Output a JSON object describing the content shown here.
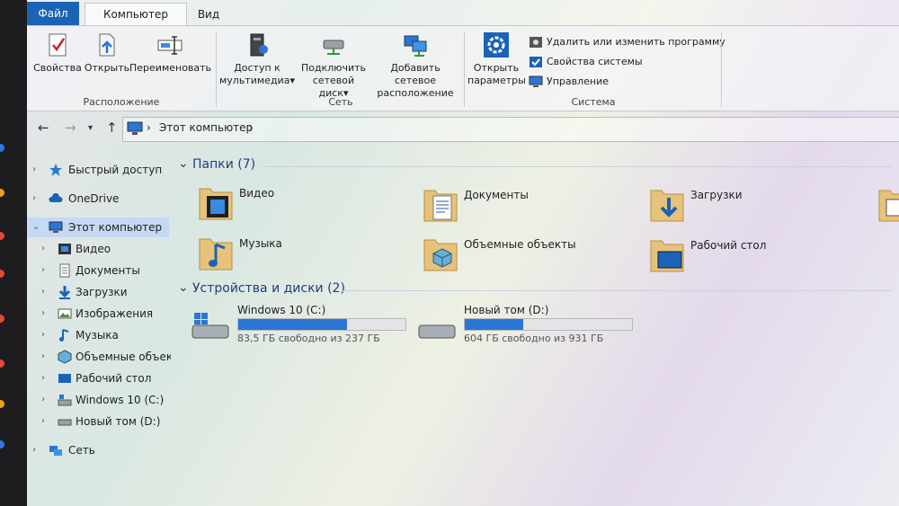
{
  "ribbon": {
    "tabs": {
      "file": "Файл",
      "computer": "Компьютер",
      "view": "Вид"
    },
    "location": {
      "properties": "Свойства",
      "open": "Открыть",
      "rename": "Переименовать",
      "label": "Расположение"
    },
    "network": {
      "media_access_line1": "Доступ к",
      "media_access_line2": "мультимедиа",
      "map_drive_line1": "Подключить",
      "map_drive_line2": "сетевой диск",
      "add_location_line1": "Добавить сетевое",
      "add_location_line2": "расположение",
      "label": "Сеть"
    },
    "system": {
      "open_settings_line1": "Открыть",
      "open_settings_line2": "параметры",
      "uninstall": "Удалить или изменить программу",
      "properties": "Свойства системы",
      "manage": "Управление",
      "label": "Система"
    }
  },
  "address": {
    "crumb": "Этот компьютер"
  },
  "sidebar": {
    "items": [
      {
        "label": "Быстрый доступ"
      },
      {
        "label": "OneDrive"
      },
      {
        "label": "Этот компьютер"
      },
      {
        "label": "Видео"
      },
      {
        "label": "Документы"
      },
      {
        "label": "Загрузки"
      },
      {
        "label": "Изображения"
      },
      {
        "label": "Музыка"
      },
      {
        "label": "Объемные объекты"
      },
      {
        "label": "Рабочий стол"
      },
      {
        "label": "Windows 10 (C:)"
      },
      {
        "label": "Новый том (D:)"
      },
      {
        "label": "Сеть"
      }
    ]
  },
  "folders_section": {
    "title": "Папки (7)",
    "items": [
      {
        "name": "Видео",
        "icon": "video-folder-icon"
      },
      {
        "name": "Документы",
        "icon": "documents-folder-icon"
      },
      {
        "name": "Загрузки",
        "icon": "downloads-folder-icon"
      },
      {
        "name": "Музыка",
        "icon": "music-folder-icon"
      },
      {
        "name": "Объемные объекты",
        "icon": "3d-objects-folder-icon"
      },
      {
        "name": "Рабочий стол",
        "icon": "desktop-folder-icon"
      }
    ]
  },
  "drives_section": {
    "title": "Устройства и диски (2)",
    "items": [
      {
        "name": "Windows 10 (C:)",
        "free": "83,5 ГБ свободно из 237 ГБ",
        "used_fraction": 0.65
      },
      {
        "name": "Новый том (D:)",
        "free": "604 ГБ свободно из 931 ГБ",
        "used_fraction": 0.35
      }
    ]
  },
  "colors": {
    "accent": "#1b63b6",
    "drive_fill": "#2a76d4",
    "selection": "#bed7f5"
  }
}
